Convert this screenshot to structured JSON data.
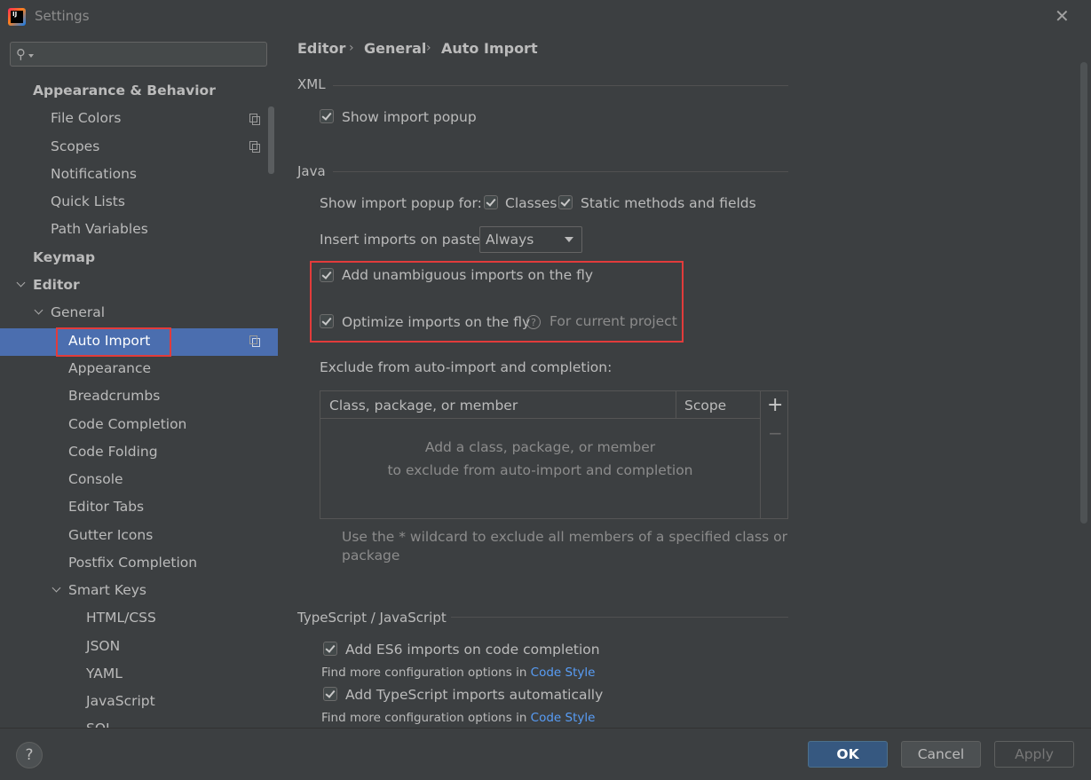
{
  "window": {
    "title": "Settings",
    "close_glyph": "✕"
  },
  "search": {
    "placeholder": ""
  },
  "sidebar": {
    "appearance_behavior": "Appearance & Behavior",
    "file_colors": "File Colors",
    "scopes": "Scopes",
    "notifications": "Notifications",
    "quick_lists": "Quick Lists",
    "path_variables": "Path Variables",
    "keymap": "Keymap",
    "editor": "Editor",
    "general": "General",
    "auto_import": "Auto Import",
    "appearance": "Appearance",
    "breadcrumbs": "Breadcrumbs",
    "code_completion": "Code Completion",
    "code_folding": "Code Folding",
    "console": "Console",
    "editor_tabs": "Editor Tabs",
    "gutter_icons": "Gutter Icons",
    "postfix_completion": "Postfix Completion",
    "smart_keys": "Smart Keys",
    "html_css": "HTML/CSS",
    "json": "JSON",
    "yaml": "YAML",
    "javascript": "JavaScript",
    "sql": "SQL"
  },
  "breadcrumb": {
    "part1": "Editor",
    "part2": "General",
    "part3": "Auto Import",
    "sep": "›"
  },
  "xml": {
    "title": "XML",
    "show_import_popup": "Show import popup"
  },
  "java": {
    "title": "Java",
    "show_import_popup_for": "Show import popup for:",
    "classes": "Classes",
    "static_methods": "Static methods and fields",
    "insert_imports_on_paste": "Insert imports on paste:",
    "insert_value": "Always",
    "add_unambiguous": "Add unambiguous imports on the fly",
    "optimize_imports": "Optimize imports on the fly",
    "for_current_project": "For current project",
    "exclude_label": "Exclude from auto-import and completion:",
    "col_class": "Class, package, or member",
    "col_scope": "Scope",
    "empty_line1": "Add a class, package, or member",
    "empty_line2": "to exclude from auto-import and completion",
    "add_glyph": "+",
    "remove_glyph": "−",
    "hint_line1": "Use the * wildcard to exclude all members of a specified class or",
    "hint_line2": "package"
  },
  "ts": {
    "title": "TypeScript / JavaScript",
    "add_es6": "Add ES6 imports on code completion",
    "find_more_1": "Find more configuration options in ",
    "code_style_1": "Code Style",
    "add_ts": "Add TypeScript imports automatically",
    "find_more_2": "Find more configuration options in ",
    "code_style_2": "Code Style"
  },
  "footer": {
    "help": "?",
    "ok": "OK",
    "cancel": "Cancel",
    "apply": "Apply"
  }
}
